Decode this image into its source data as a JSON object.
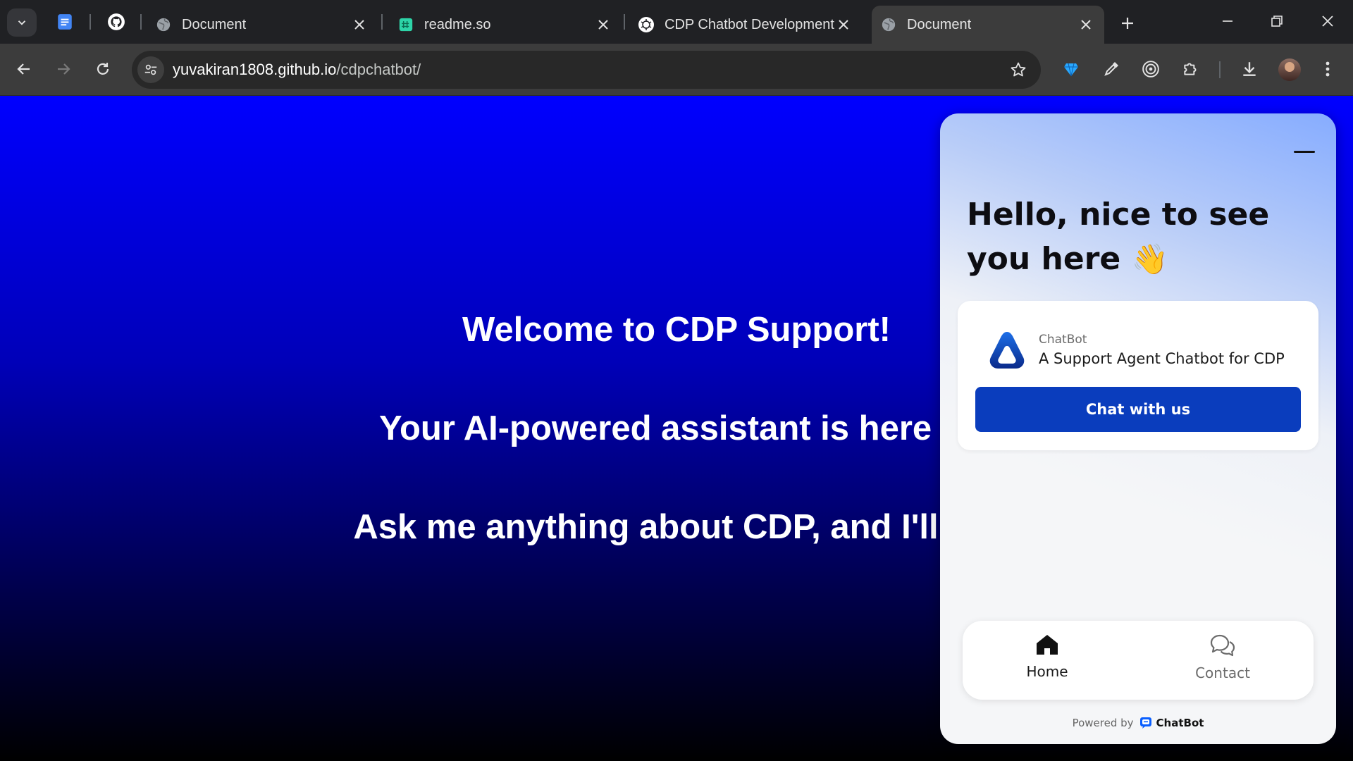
{
  "browser": {
    "tabs": [
      {
        "title": "Document",
        "favicon": "globe-icon",
        "active": false
      },
      {
        "title": "readme.so",
        "favicon": "readme-icon",
        "active": false
      },
      {
        "title": "CDP Chatbot Development",
        "favicon": "openai-icon",
        "active": false
      },
      {
        "title": "Document",
        "favicon": "globe-icon",
        "active": true
      }
    ],
    "pinned_tabs": [
      "google-docs-icon",
      "github-icon"
    ],
    "url_host": "yuvakiran1808.github.io",
    "url_path": "/cdpchatbot/",
    "extensions": [
      "gem-icon",
      "eyedropper-icon",
      "target-icon",
      "puzzle-icon",
      "download-icon",
      "avatar",
      "kebab-menu-icon"
    ]
  },
  "page": {
    "hero_lines": [
      "Welcome to CDP Support!",
      "Your AI-powered assistant is here to",
      "Ask me anything about CDP, and I'll gui"
    ],
    "background_colors": [
      "#0000ff",
      "#000000"
    ]
  },
  "widget": {
    "greeting_line1": "Hello, nice to see",
    "greeting_line2": "you here",
    "greeting_emoji": "👋",
    "bot_name": "ChatBot",
    "bot_description": "A Support Agent Chatbot for CDP",
    "chat_button": "Chat with us",
    "nav": [
      {
        "label": "Home",
        "icon": "home-icon",
        "active": true
      },
      {
        "label": "Contact",
        "icon": "chat-bubbles-icon",
        "active": false
      }
    ],
    "powered_by": "Powered by",
    "brand": "ChatBot",
    "accent": "#0a3dbd"
  }
}
